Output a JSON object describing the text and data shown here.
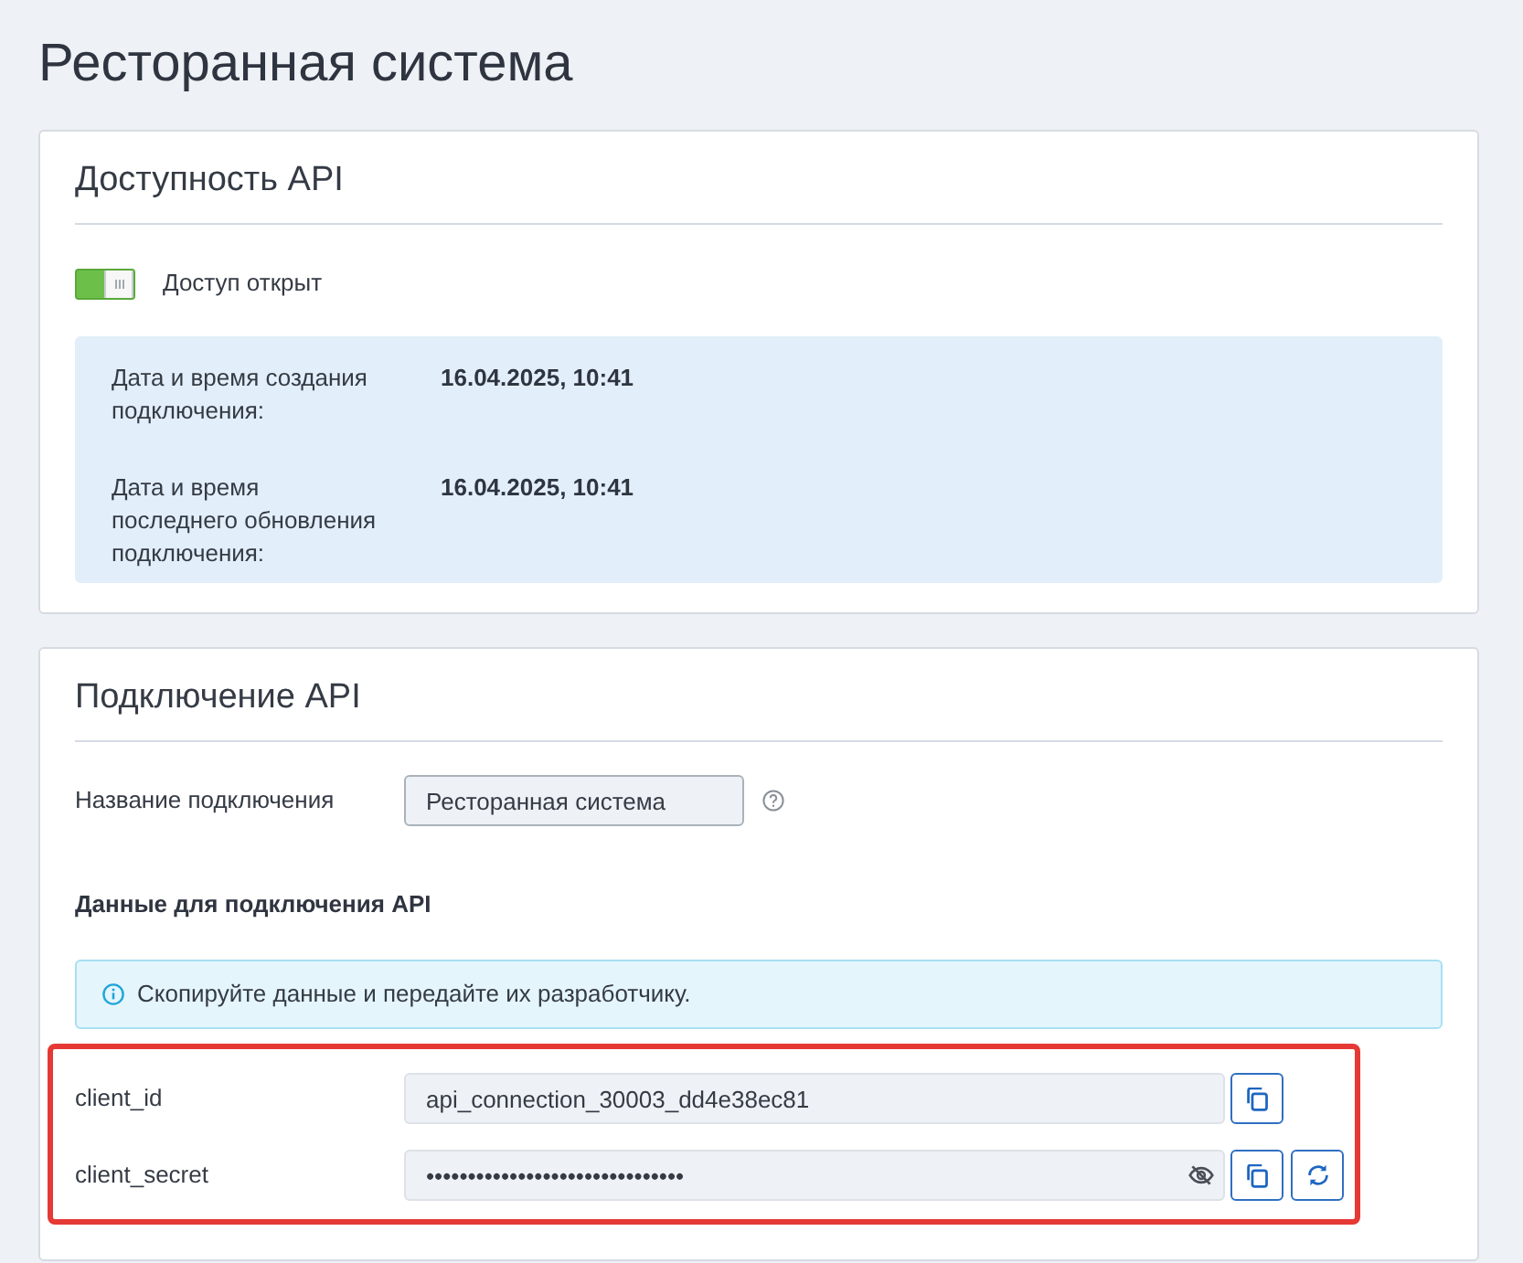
{
  "page": {
    "title": "Ресторанная система"
  },
  "availability": {
    "title": "Доступность API",
    "toggle": {
      "on": true,
      "label": "Доступ открыт"
    },
    "details": [
      {
        "label": "Дата и время создания подключения:",
        "value": "16.04.2025, 10:41"
      },
      {
        "label": "Дата и время последнего обновления подключения:",
        "value": "16.04.2025, 10:41"
      }
    ]
  },
  "connection": {
    "title": "Подключение API",
    "name_field": {
      "label": "Название подключения",
      "value": "Ресторанная система"
    },
    "credentials_heading": "Данные для подключения API",
    "notice": "Скопируйте данные и передайте их разработчику.",
    "credentials": {
      "highlighted": true,
      "fields": [
        {
          "kind": "plain",
          "label": "client_id",
          "value": "api_connection_30003_dd4e38ec81"
        },
        {
          "kind": "secret",
          "label": "client_secret",
          "value": "•••••••••••••••••••••••••••••••"
        }
      ]
    }
  }
}
